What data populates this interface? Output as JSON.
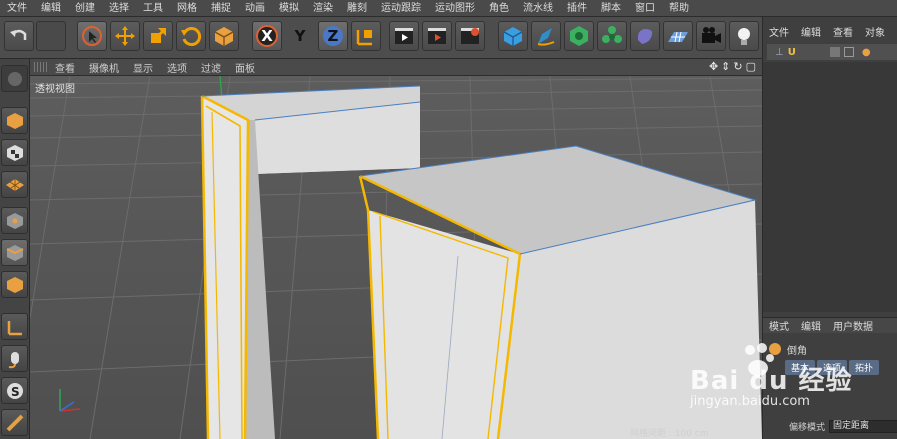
{
  "menu": [
    "文件",
    "编辑",
    "创建",
    "选择",
    "工具",
    "网格",
    "捕捉",
    "动画",
    "模拟",
    "渲染",
    "雕刻",
    "运动跟踪",
    "运动图形",
    "角色",
    "流水线",
    "插件",
    "脚本",
    "窗口",
    "帮助"
  ],
  "toolbar": {
    "icons": [
      "undo-icon",
      "live-selection-icon",
      "move-icon",
      "scale-icon",
      "rotate-icon",
      "last-object-icon",
      "x-axis-icon",
      "y-axis-icon",
      "z-axis-icon",
      "coordinate-system-icon",
      "render-view-icon",
      "render-picture-viewer-icon",
      "render-settings-icon",
      "cube-icon",
      "pen-icon",
      "subdivision-icon",
      "cloner-icon",
      "deformer-icon",
      "floor-icon",
      "camera-icon",
      "light-icon"
    ],
    "x_label": "X",
    "y_label": "Y",
    "z_label": "Z"
  },
  "viewport_menu": [
    "查看",
    "摄像机",
    "显示",
    "选项",
    "过滤",
    "面板"
  ],
  "viewport": {
    "label": "透视视图",
    "grid_spacing_text": "网格间距 : 100 cm"
  },
  "object_manager": {
    "menu": [
      "文件",
      "编辑",
      "查看",
      "对象"
    ],
    "object_name": "U"
  },
  "attribute_manager": {
    "menu": [
      "模式",
      "编辑",
      "用户数据"
    ],
    "object_label": "倒角",
    "tabs": [
      "基本",
      "选项",
      "拓扑"
    ],
    "fields": [
      {
        "label": "偏移模式",
        "value": "固定距离"
      }
    ]
  },
  "watermark": {
    "main": "Bai du 经验",
    "sub": "jingyan.baidu.com"
  },
  "colors": {
    "selection": "#f5b800",
    "edge": "#4a7fc0",
    "grid": "#6a6a6a"
  }
}
